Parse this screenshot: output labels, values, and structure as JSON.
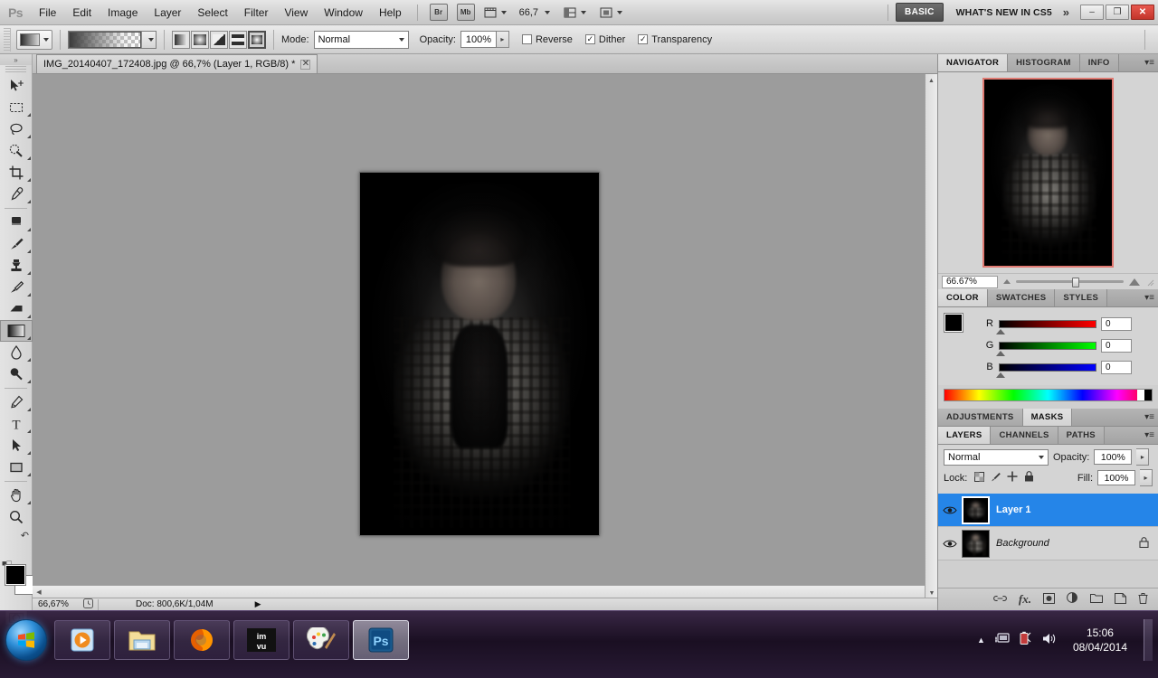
{
  "app": {
    "logo": "Ps",
    "menus": [
      "File",
      "Edit",
      "Image",
      "Layer",
      "Select",
      "Filter",
      "View",
      "Window",
      "Help"
    ],
    "bridge_label": "Br",
    "minibridge_label": "Mb",
    "zoom_level": "66,7",
    "workspace_basic": "BASIC",
    "whats_new": "WHAT'S NEW IN CS5",
    "more_chevron": "»",
    "window_buttons": {
      "minimize": "–",
      "restore": "❐",
      "close": "✕"
    }
  },
  "options_bar": {
    "tool_name": "gradient-tool",
    "gradient_picker_label": "",
    "gradient_types": [
      "linear",
      "radial",
      "angle",
      "reflected",
      "diamond"
    ],
    "gradient_type_active": 4,
    "mode_label": "Mode:",
    "mode_value": "Normal",
    "opacity_label": "Opacity:",
    "opacity_value": "100%",
    "checkboxes": [
      {
        "label": "Reverse",
        "checked": false,
        "mark": ""
      },
      {
        "label": "Dither",
        "checked": true,
        "mark": "✓"
      },
      {
        "label": "Transparency",
        "checked": true,
        "mark": "✓"
      }
    ]
  },
  "toolbox": {
    "tools": [
      "move-tool",
      "rectangular-marquee-tool",
      "lasso-tool",
      "quick-selection-tool",
      "crop-tool",
      "eyedropper-tool",
      "spot-healing-brush-tool",
      "brush-tool",
      "clone-stamp-tool",
      "history-brush-tool",
      "eraser-tool",
      "gradient-tool",
      "blur-tool",
      "dodge-tool",
      "pen-tool",
      "horizontal-type-tool",
      "path-selection-tool",
      "rectangle-tool",
      "hand-tool",
      "zoom-tool"
    ],
    "selected_tool": "gradient-tool",
    "foreground_color": "#000000",
    "background_color": "#ffffff",
    "quick_mask": "edit-in-quick-mask-mode"
  },
  "document": {
    "tab_title": "IMG_20140407_172408.jpg @ 66,7% (Layer 1, RGB/8) *",
    "close_glyph": "✕",
    "status_zoom": "66,67%",
    "status_doc": "Doc: 800,6K/1,04M",
    "status_arrow": "▶"
  },
  "navigator_panel": {
    "tabs": [
      "NAVIGATOR",
      "HISTOGRAM",
      "INFO"
    ],
    "active_tab": "NAVIGATOR",
    "menu_glyph": "▾≡",
    "zoom_value": "66.67%",
    "view_box_color": "#e07a72"
  },
  "color_panel": {
    "tabs": [
      "COLOR",
      "SWATCHES",
      "STYLES"
    ],
    "active_tab": "COLOR",
    "menu_glyph": "▾≡",
    "channels": [
      {
        "label": "R",
        "value": "0"
      },
      {
        "label": "G",
        "value": "0"
      },
      {
        "label": "B",
        "value": "0"
      }
    ]
  },
  "adjustments_panel": {
    "tabs": [
      "ADJUSTMENTS",
      "MASKS"
    ],
    "active_tab": "MASKS",
    "menu_glyph": "▾≡"
  },
  "layers_panel": {
    "tabs": [
      "LAYERS",
      "CHANNELS",
      "PATHS"
    ],
    "active_tab": "LAYERS",
    "menu_glyph": "▾≡",
    "blend_mode": "Normal",
    "opacity_label": "Opacity:",
    "opacity_value": "100%",
    "lock_label": "Lock:",
    "lock_icons": [
      "lock-transparent-pixels-icon",
      "lock-image-pixels-icon",
      "lock-position-icon",
      "lock-all-icon"
    ],
    "fill_label": "Fill:",
    "fill_value": "100%",
    "layers": [
      {
        "name": "Layer 1",
        "visible": true,
        "selected": true,
        "locked": false,
        "style": "bold"
      },
      {
        "name": "Background",
        "visible": true,
        "selected": false,
        "locked": true,
        "style": "italic"
      }
    ],
    "footer_icons": [
      "link-layers-icon",
      "add-layer-style-icon",
      "add-layer-mask-icon",
      "new-adjustment-layer-icon",
      "new-group-icon",
      "new-layer-icon",
      "delete-layer-icon"
    ],
    "footer_glyphs": [
      "⚭",
      "fx.",
      "▣",
      "◑.",
      "▭",
      "⧉",
      "🗑"
    ]
  },
  "taskbar": {
    "start_button": "windows-start-orb",
    "items": [
      {
        "name": "windows-media-player",
        "label": "▶"
      },
      {
        "name": "windows-explorer",
        "label": ""
      },
      {
        "name": "mozilla-firefox",
        "label": ""
      },
      {
        "name": "imvu",
        "label": "imvu"
      },
      {
        "name": "microsoft-paint",
        "label": ""
      },
      {
        "name": "adobe-photoshop",
        "label": "Ps"
      }
    ],
    "active_item": "adobe-photoshop",
    "tray_icons": [
      "show-hidden-icons-chevron",
      "network-icon",
      "battery-icon",
      "volume-icon"
    ],
    "tray_glyphs": [
      "▲",
      "🖥",
      "🔋",
      "🔊"
    ],
    "clock_time": "15:06",
    "clock_date": "08/04/2014"
  }
}
